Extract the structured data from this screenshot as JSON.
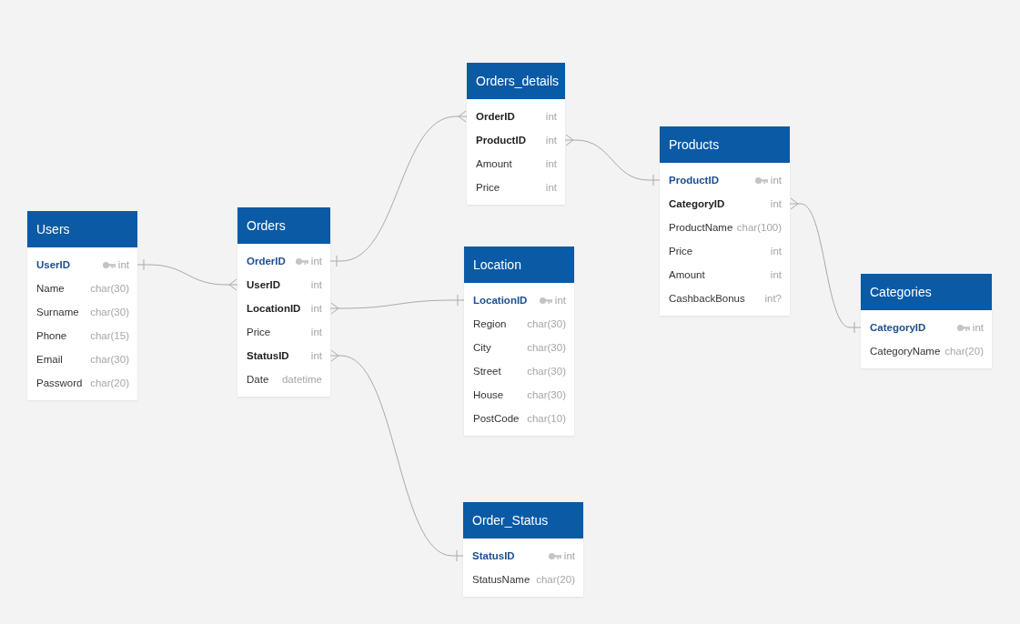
{
  "tables": [
    {
      "title": "Users",
      "fields": [
        {
          "name": "UserID",
          "type": "int",
          "kind": "pk"
        },
        {
          "name": "Name",
          "type": "char(30)",
          "kind": "plain"
        },
        {
          "name": "Surname",
          "type": "char(30)",
          "kind": "plain"
        },
        {
          "name": "Phone",
          "type": "char(15)",
          "kind": "plain"
        },
        {
          "name": "Email",
          "type": "char(30)",
          "kind": "plain"
        },
        {
          "name": "Password",
          "type": "char(20)",
          "kind": "plain"
        }
      ]
    },
    {
      "title": "Orders",
      "fields": [
        {
          "name": "OrderID",
          "type": "int",
          "kind": "pk"
        },
        {
          "name": "UserID",
          "type": "int",
          "kind": "fk"
        },
        {
          "name": "LocationID",
          "type": "int",
          "kind": "fk"
        },
        {
          "name": "Price",
          "type": "int",
          "kind": "plain"
        },
        {
          "name": "StatusID",
          "type": "int",
          "kind": "fk"
        },
        {
          "name": "Date",
          "type": "datetime",
          "kind": "plain"
        }
      ]
    },
    {
      "title": "Orders_details",
      "fields": [
        {
          "name": "OrderID",
          "type": "int",
          "kind": "fk"
        },
        {
          "name": "ProductID",
          "type": "int",
          "kind": "fk"
        },
        {
          "name": "Amount",
          "type": "int",
          "kind": "plain"
        },
        {
          "name": "Price",
          "type": "int",
          "kind": "plain"
        }
      ]
    },
    {
      "title": "Location",
      "fields": [
        {
          "name": "LocationID",
          "type": "int",
          "kind": "pk"
        },
        {
          "name": "Region",
          "type": "char(30)",
          "kind": "plain"
        },
        {
          "name": "City",
          "type": "char(30)",
          "kind": "plain"
        },
        {
          "name": "Street",
          "type": "char(30)",
          "kind": "plain"
        },
        {
          "name": "House",
          "type": "char(30)",
          "kind": "plain"
        },
        {
          "name": "PostCode",
          "type": "char(10)",
          "kind": "plain"
        }
      ]
    },
    {
      "title": "Products",
      "fields": [
        {
          "name": "ProductID",
          "type": "int",
          "kind": "pk"
        },
        {
          "name": "CategoryID",
          "type": "int",
          "kind": "fk"
        },
        {
          "name": "ProductName",
          "type": "char(100)",
          "kind": "plain"
        },
        {
          "name": "Price",
          "type": "int",
          "kind": "plain"
        },
        {
          "name": "Amount",
          "type": "int",
          "kind": "plain"
        },
        {
          "name": "CashbackBonus",
          "type": "int?",
          "kind": "plain"
        }
      ]
    },
    {
      "title": "Categories",
      "fields": [
        {
          "name": "CategoryID",
          "type": "int",
          "kind": "pk"
        },
        {
          "name": "CategoryName",
          "type": "char(20)",
          "kind": "plain"
        }
      ]
    },
    {
      "title": "Order_Status",
      "fields": [
        {
          "name": "StatusID",
          "type": "int",
          "kind": "pk"
        },
        {
          "name": "StatusName",
          "type": "char(20)",
          "kind": "plain"
        }
      ]
    }
  ]
}
